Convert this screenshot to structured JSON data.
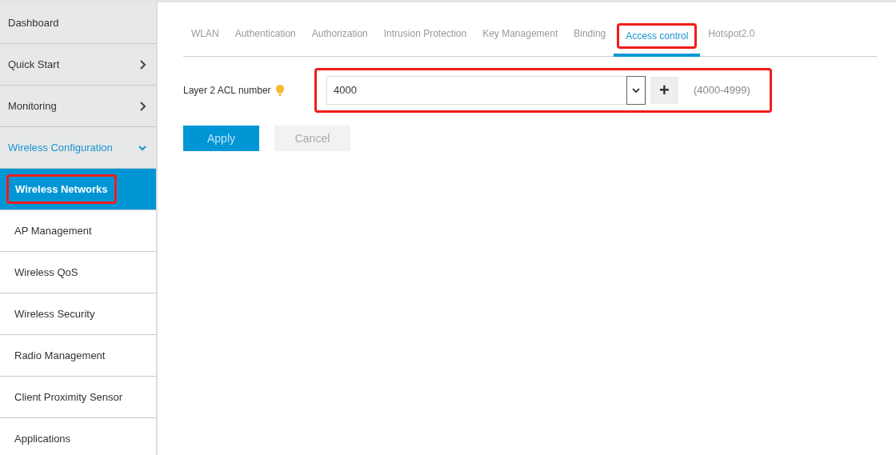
{
  "sidebar": {
    "items": [
      {
        "label": "Dashboard",
        "expandable": false,
        "expanded": false
      },
      {
        "label": "Quick Start",
        "expandable": true,
        "expanded": false
      },
      {
        "label": "Monitoring",
        "expandable": true,
        "expanded": false
      },
      {
        "label": "Wireless Configuration",
        "expandable": true,
        "expanded": true,
        "children": [
          {
            "label": "Wireless Networks",
            "selected": true,
            "annotated": true
          },
          {
            "label": "AP Management",
            "selected": false,
            "annotated": false
          },
          {
            "label": "Wireless QoS",
            "selected": false,
            "annotated": false
          },
          {
            "label": "Wireless Security",
            "selected": false,
            "annotated": false
          },
          {
            "label": "Radio Management",
            "selected": false,
            "annotated": false
          },
          {
            "label": "Client Proximity Sensor",
            "selected": false,
            "annotated": false
          },
          {
            "label": "Applications",
            "selected": false,
            "annotated": false
          }
        ]
      }
    ]
  },
  "tabs": [
    {
      "label": "WLAN",
      "selected": false,
      "annotated": false
    },
    {
      "label": "Authentication",
      "selected": false,
      "annotated": false
    },
    {
      "label": "Authorization",
      "selected": false,
      "annotated": false
    },
    {
      "label": "Intrusion Protection",
      "selected": false,
      "annotated": false
    },
    {
      "label": "Key Management",
      "selected": false,
      "annotated": false
    },
    {
      "label": "Binding",
      "selected": false,
      "annotated": false
    },
    {
      "label": "Access control",
      "selected": true,
      "annotated": true
    },
    {
      "label": "Hotspot2.0",
      "selected": false,
      "annotated": false
    }
  ],
  "form": {
    "label": "Layer 2 ACL number",
    "hint": true,
    "value": "4000",
    "plus": "+",
    "range": "(4000-4999)",
    "annotated": true
  },
  "buttons": [
    {
      "label": "Apply",
      "kind": "primary",
      "disabled": false
    },
    {
      "label": "Cancel",
      "kind": "secondary",
      "disabled": true
    }
  ]
}
